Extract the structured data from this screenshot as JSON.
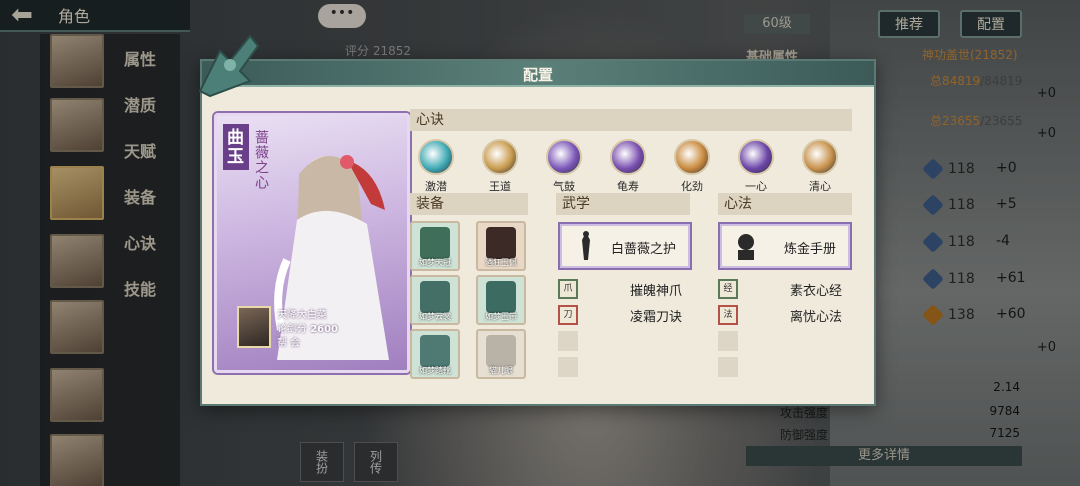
{
  "topbar": {
    "title": "角色"
  },
  "sidebar": {
    "items": [
      "属性",
      "潜质",
      "天赋",
      "装备",
      "心诀",
      "技能"
    ]
  },
  "background": {
    "chat_dots": "•••",
    "score": "评分 21852",
    "level": "60级",
    "btn_recommend": "推荐",
    "btn_config": "配置",
    "attr_title": "基础属性",
    "attr_rank": "神功盖世(21852)",
    "stat_hp": {
      "cur": "总84819",
      "max": "/84819"
    },
    "stat_mp": {
      "cur": "总23655",
      "max": "/23655"
    },
    "plus0_a": "+0",
    "plus0_b": "+0",
    "attr_rows": [
      {
        "val": "118",
        "delta": "+0"
      },
      {
        "val": "118",
        "delta": "+5"
      },
      {
        "val": "118",
        "delta": "-4"
      },
      {
        "val": "118",
        "delta": "+61"
      },
      {
        "val": "138",
        "delta": "+60"
      }
    ],
    "plus0_c": "+0",
    "bottom_stats": [
      {
        "label": "",
        "value": "2.14"
      },
      {
        "label": "攻击强度",
        "value": "9784"
      },
      {
        "label": "防御强度",
        "value": "7125"
      }
    ],
    "more_detail": "更多详情",
    "bottom_tabs": [
      "装扮",
      "列传"
    ],
    "accent": "#5b7a74"
  },
  "dialog": {
    "title": "配置",
    "card": {
      "name": "曲玉",
      "subtitle": "蔷薇之心",
      "player_name": "天降大白菜",
      "score_label": "论剑分",
      "score_value": "2600",
      "guild_label": "帮 会"
    },
    "xinjue": {
      "header": "心诀",
      "orbs": [
        {
          "label": "激潜",
          "color": "#3fa9b4"
        },
        {
          "label": "王道",
          "color": "#c99b4e"
        },
        {
          "label": "气鼓",
          "color": "#7b57b8"
        },
        {
          "label": "龟寿",
          "color": "#7a4fb0"
        },
        {
          "label": "化劲",
          "color": "#c98a3e"
        },
        {
          "label": "一心",
          "color": "#6c45a8"
        },
        {
          "label": "清心",
          "color": "#c7914a"
        }
      ]
    },
    "equip": {
      "header": "装备",
      "items": [
        {
          "label": "如梦天冠",
          "bg": "#cfe2d6",
          "art": "#3f6e5a"
        },
        {
          "label": "酒狂玉佩",
          "bg": "#ead8c7",
          "art": "#3b2a25"
        },
        {
          "label": "如梦云裳",
          "bg": "#cfe2d6",
          "art": "#436f66"
        },
        {
          "label": "如梦玉带",
          "bg": "#cfe2d6",
          "art": "#3c6b62"
        },
        {
          "label": "如梦踏靴",
          "bg": "#cfe2d6",
          "art": "#4f7a74"
        },
        {
          "label": "猫儿眼",
          "bg": "#e6dfd2",
          "art": "#b9b2a6"
        }
      ]
    },
    "wuxue": {
      "header": "武学",
      "main": "白蔷薇之护",
      "skills": [
        "摧魄神爪",
        "凌霜刀诀"
      ]
    },
    "xinfa": {
      "header": "心法",
      "main": "炼金手册",
      "skills": [
        "素衣心经",
        "离忧心法"
      ]
    }
  }
}
